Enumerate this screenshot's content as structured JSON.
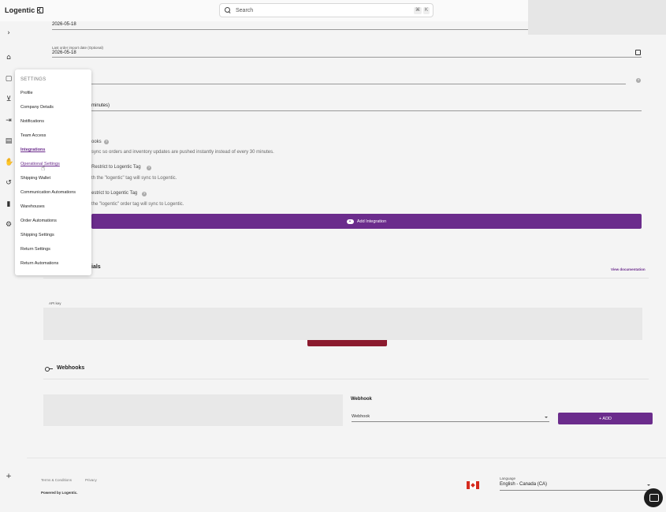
{
  "app": {
    "logo": "Logentic"
  },
  "search": {
    "placeholder": "Search",
    "shortcut_mod": "⌘",
    "shortcut_key": "K"
  },
  "form": {
    "first_date_value": "2026-05-18",
    "last_order_label": "Last order import date (Optional)",
    "last_order_value": "2026-05-18",
    "interval_suffix": "minutes)",
    "webhooks_toggle_label": "ooks",
    "webhooks_desc": "sync so orders and inventory updates are pushed instantly instead of every 30 minutes.",
    "restrict_tag_label_1": "Restrict to Logentic Tag",
    "restrict_tag_desc_1": "th the \"logentic\" tag will sync to Logentic.",
    "restrict_tag_label_2": "estrict to Logentic Tag",
    "restrict_tag_desc_2": "the \"logentic\" order tag will sync to Logentic.",
    "add_integration": "Add Integration"
  },
  "credentials": {
    "title_partial": "ials",
    "view_docs": "View documentation",
    "api_key_label": "API key"
  },
  "webhooks": {
    "title": "Webhooks",
    "field_title": "Webhook",
    "select_value": "Webhook",
    "add_label": "+ ADD"
  },
  "footer": {
    "terms": "Terms & Conditions",
    "privacy": "Privacy",
    "powered": "Powered by Logentic.",
    "language_label": "Language",
    "language_value": "English - Canada (CA)"
  },
  "menu": {
    "header": "SETTINGS",
    "items": [
      {
        "label": "Profile"
      },
      {
        "label": "Company Details"
      },
      {
        "label": "Notifications"
      },
      {
        "label": "Team Access"
      },
      {
        "label": "Integrations"
      },
      {
        "label": "Operational Settings"
      },
      {
        "label": "Shipping Wallet"
      },
      {
        "label": "Communication Automations"
      },
      {
        "label": "Warehouses"
      },
      {
        "label": "Order Automations"
      },
      {
        "label": "Shipping Settings"
      },
      {
        "label": "Return Settings"
      },
      {
        "label": "Return Automations"
      }
    ]
  },
  "rail": {
    "icons": [
      "chevron-right-icon",
      "home-icon",
      "box-icon",
      "cart-icon",
      "inbox-icon",
      "document-icon",
      "hand-icon",
      "return-icon",
      "chart-icon",
      "gear-icon",
      "plus-icon"
    ]
  },
  "colors": {
    "accent": "#6b2c8c",
    "danger": "#8b1a2e"
  }
}
